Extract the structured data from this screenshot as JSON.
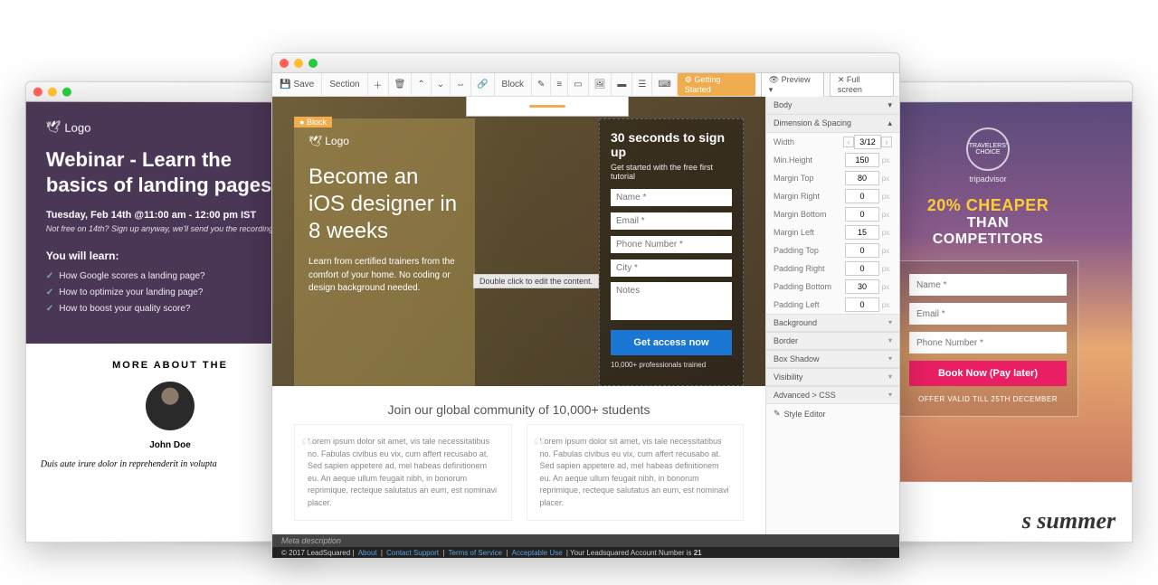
{
  "left": {
    "logo": "Logo",
    "headline": "Webinar - Learn the basics of landing pages",
    "date": "Tuesday, Feb 14th @11:00 am - 12:00 pm IST",
    "note": "Not free on 14th? Sign up anyway, we'll send you the recording.",
    "learn_title": "You will learn:",
    "bullets": [
      "How Google scores a landing page?",
      "How to optimize your landing page?",
      "How to boost your quality score?"
    ],
    "more_title": "MORE ABOUT THE",
    "name": "John Doe",
    "bio": "Duis aute irure dolor in reprehenderit in volupta"
  },
  "center": {
    "toolbar": {
      "save": "Save",
      "section": "Section",
      "block": "Block",
      "getting_started": "Getting Started",
      "preview": "Preview",
      "fullscreen": "Full screen"
    },
    "block_tag": "Block",
    "logo": "Logo",
    "headline": "Become an iOS designer in 8 weeks",
    "sub": "Learn from certified trainers from the comfort of your home. No coding or design background needed.",
    "hint": "Double click to edit the content.",
    "form": {
      "title": "30 seconds to sign up",
      "desc": "Get started with the free first tutorial",
      "fields": {
        "name": "Name *",
        "email": "Email *",
        "phone": "Phone Number *",
        "city": "City *",
        "notes": "Notes"
      },
      "cta": "Get access now",
      "footer": "10,000+ professionals trained"
    },
    "community": "Join our global community of 10,000+ students",
    "testi": "Lorem ipsum dolor sit amet, vis tale necessitatibus no. Fabulas civibus eu vix, cum affert recusabo at. Sed sapien appetere ad, mel habeas definitionem eu. An aeque ullum feugait nibh, in bonorum reprimique, recteque salutatus an eum, est nominavi placer.",
    "meta": "Meta description",
    "footer": {
      "copyright": "© 2017 LeadSquared",
      "links": [
        "About",
        "Contact Support",
        "Terms of Service",
        "Acceptable Use"
      ],
      "account": "Your Leadsquared Account Number is",
      "account_no": "21"
    },
    "props": {
      "selector": "Body",
      "section": "Dimension & Spacing",
      "width": {
        "label": "Width",
        "value": "3/12"
      },
      "rows": [
        {
          "label": "Min.Height",
          "value": "150",
          "unit": "px"
        },
        {
          "label": "Margin Top",
          "value": "80",
          "unit": "px"
        },
        {
          "label": "Margin Right",
          "value": "0",
          "unit": "px"
        },
        {
          "label": "Margin Bottom",
          "value": "0",
          "unit": "px"
        },
        {
          "label": "Margin Left",
          "value": "15",
          "unit": "px"
        },
        {
          "label": "Padding Top",
          "value": "0",
          "unit": "px"
        },
        {
          "label": "Padding Right",
          "value": "0",
          "unit": "px"
        },
        {
          "label": "Padding Bottom",
          "value": "30",
          "unit": "px"
        },
        {
          "label": "Padding Left",
          "value": "0",
          "unit": "px"
        }
      ],
      "panels": [
        "Background",
        "Border",
        "Box Shadow",
        "Visibility",
        "Advanced > CSS"
      ],
      "style_editor": "Style Editor"
    }
  },
  "right": {
    "badge": "TRAVELERS' CHOICE",
    "ta": "tripadvisor",
    "promo1": "20% CHEAPER",
    "promo2_a": "THAN",
    "promo2_b": "COMPETITORS",
    "fields": {
      "name": "Name *",
      "email": "Email *",
      "phone": "Phone Number *"
    },
    "cta": "Book Now (Pay later)",
    "offer": "OFFER VALID TILL 25TH DECEMBER",
    "summer": "s summer"
  }
}
